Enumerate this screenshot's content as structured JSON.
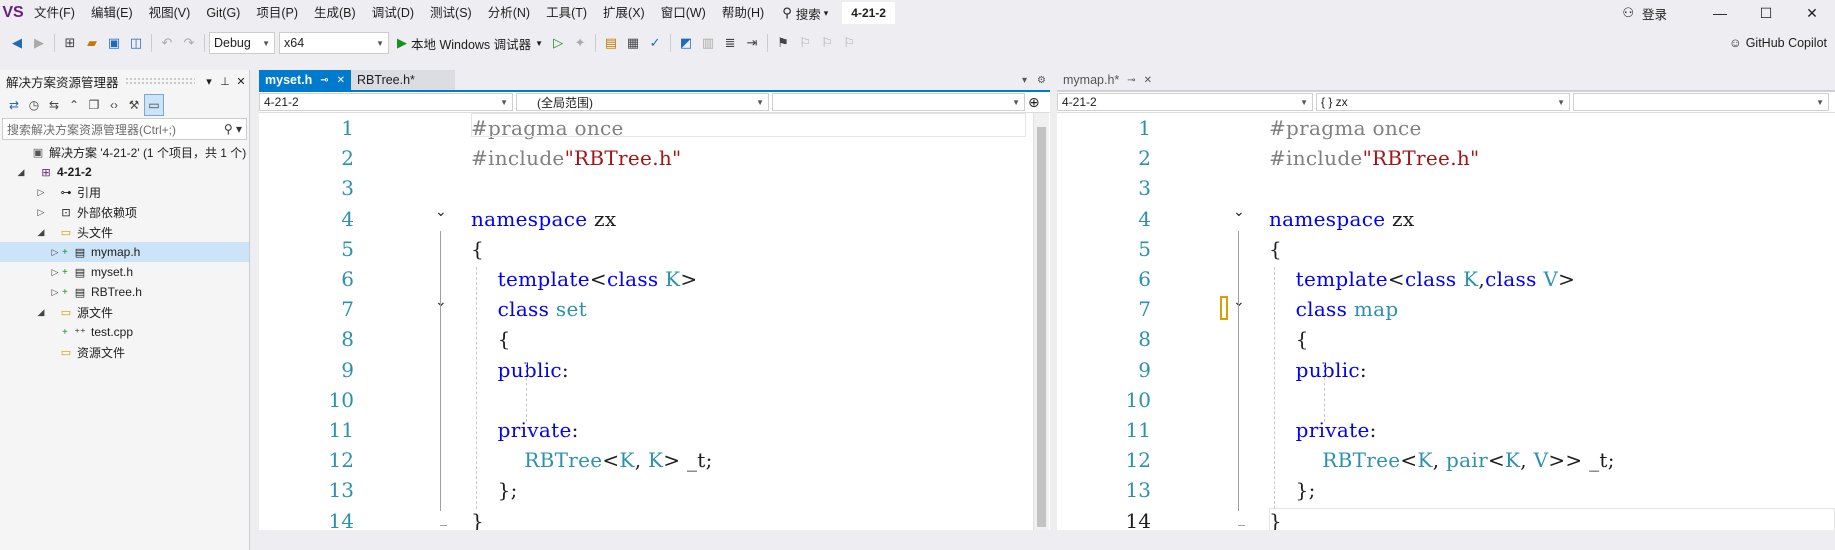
{
  "menubar": {
    "logo": "VS",
    "items": [
      "文件(F)",
      "编辑(E)",
      "视图(V)",
      "Git(G)",
      "项目(P)",
      "生成(B)",
      "调试(D)",
      "测试(S)",
      "分析(N)",
      "工具(T)",
      "扩展(X)",
      "窗口(W)",
      "帮助(H)"
    ],
    "search_label": "搜索",
    "search_arrow": "▾",
    "project_badge": "4-21-2",
    "login_label": "登录",
    "win_minimize": "—",
    "win_maximize": "☐",
    "win_close": "✕"
  },
  "toolbar": {
    "config": "Debug",
    "platform": "x64",
    "run_label": "本地 Windows 调试器",
    "copilot_label": "GitHub Copilot"
  },
  "solution_explorer": {
    "title": "解决方案资源管理器",
    "search_placeholder": "搜索解决方案资源管理器(Ctrl+;)",
    "tree": [
      {
        "label": "解决方案 '4-21-2' (1 个项目，共 1 个)",
        "expander": "",
        "icon": "▣",
        "plus": ""
      },
      {
        "label": "4-21-2",
        "expander": "◢",
        "icon": "⊞",
        "plus": "",
        "bold": true
      },
      {
        "label": "引用",
        "expander": "▷",
        "icon": "⊶",
        "plus": ""
      },
      {
        "label": "外部依赖项",
        "expander": "▷",
        "icon": "⊡",
        "plus": ""
      },
      {
        "label": "头文件",
        "expander": "◢",
        "icon": "▭",
        "plus": ""
      },
      {
        "label": "mymap.h",
        "expander": "▷",
        "icon": "▤",
        "plus": "+",
        "selected": true
      },
      {
        "label": "myset.h",
        "expander": "▷",
        "icon": "▤",
        "plus": "+"
      },
      {
        "label": "RBTree.h",
        "expander": "▷",
        "icon": "▤",
        "plus": "+"
      },
      {
        "label": "源文件",
        "expander": "◢",
        "icon": "▭",
        "plus": ""
      },
      {
        "label": "test.cpp",
        "expander": "",
        "icon": "⁺⁺",
        "plus": "+"
      },
      {
        "label": "资源文件",
        "expander": "",
        "icon": "▭",
        "plus": ""
      }
    ]
  },
  "editor_left": {
    "tabs": [
      {
        "label": "myset.h",
        "active": true
      },
      {
        "label": "RBTree.h*",
        "active": false
      }
    ],
    "nav_project": "4-21-2",
    "nav_scope": "(全局范围)",
    "nav_member": "",
    "lines": [
      [
        [
          "p",
          "#pragma once"
        ]
      ],
      [
        [
          "p",
          "#include"
        ],
        [
          "s",
          "\"RBTree.h\""
        ]
      ],
      [],
      [
        [
          "k",
          "namespace"
        ],
        [
          "o",
          " zx"
        ]
      ],
      [
        [
          "o",
          "{"
        ]
      ],
      [
        [
          "o",
          "    "
        ],
        [
          "k",
          "template"
        ],
        [
          "o",
          "<"
        ],
        [
          "k",
          "class"
        ],
        [
          "o",
          " "
        ],
        [
          "t",
          "K"
        ],
        [
          "o",
          ">"
        ]
      ],
      [
        [
          "o",
          "    "
        ],
        [
          "k",
          "class"
        ],
        [
          "o",
          " "
        ],
        [
          "t",
          "set"
        ]
      ],
      [
        [
          "o",
          "    {"
        ]
      ],
      [
        [
          "o",
          "    "
        ],
        [
          "k",
          "public"
        ],
        [
          "o",
          ":"
        ]
      ],
      [],
      [
        [
          "o",
          "    "
        ],
        [
          "k",
          "private"
        ],
        [
          "o",
          ":"
        ]
      ],
      [
        [
          "o",
          "        "
        ],
        [
          "t",
          "RBTree"
        ],
        [
          "o",
          "<"
        ],
        [
          "t",
          "K"
        ],
        [
          "o",
          ", "
        ],
        [
          "t",
          "K"
        ],
        [
          "o",
          "> _t;"
        ]
      ],
      [
        [
          "o",
          "    };"
        ]
      ],
      [
        [
          "o",
          "}"
        ]
      ]
    ]
  },
  "editor_right": {
    "tabs": [
      {
        "label": "mymap.h*",
        "active": false
      }
    ],
    "nav_project": "4-21-2",
    "nav_scope": "{ } zx",
    "nav_member": "",
    "lines": [
      [
        [
          "p",
          "#pragma once"
        ]
      ],
      [
        [
          "p",
          "#include"
        ],
        [
          "s",
          "\"RBTree.h\""
        ]
      ],
      [],
      [
        [
          "k",
          "namespace"
        ],
        [
          "o",
          " zx"
        ]
      ],
      [
        [
          "o",
          "{"
        ]
      ],
      [
        [
          "o",
          "    "
        ],
        [
          "k",
          "template"
        ],
        [
          "o",
          "<"
        ],
        [
          "k",
          "class"
        ],
        [
          "o",
          " "
        ],
        [
          "t",
          "K"
        ],
        [
          "o",
          ","
        ],
        [
          "k",
          "class"
        ],
        [
          "o",
          " "
        ],
        [
          "t",
          "V"
        ],
        [
          "o",
          ">"
        ]
      ],
      [
        [
          "o",
          "    "
        ],
        [
          "k",
          "class"
        ],
        [
          "o",
          " "
        ],
        [
          "t",
          "map"
        ]
      ],
      [
        [
          "o",
          "    {"
        ]
      ],
      [
        [
          "o",
          "    "
        ],
        [
          "k",
          "public"
        ],
        [
          "o",
          ":"
        ]
      ],
      [],
      [
        [
          "o",
          "    "
        ],
        [
          "k",
          "private"
        ],
        [
          "o",
          ":"
        ]
      ],
      [
        [
          "o",
          "        "
        ],
        [
          "t",
          "RBTree"
        ],
        [
          "o",
          "<"
        ],
        [
          "t",
          "K"
        ],
        [
          "o",
          ", "
        ],
        [
          "t",
          "pair"
        ],
        [
          "o",
          "<"
        ],
        [
          "t",
          "K"
        ],
        [
          "o",
          ", "
        ],
        [
          "t",
          "V"
        ],
        [
          "o",
          ">> _t;"
        ]
      ],
      [
        [
          "o",
          "    };"
        ]
      ],
      [
        [
          "o",
          "}"
        ]
      ]
    ],
    "current_line": 14
  },
  "line_numbers": [
    "1",
    "2",
    "3",
    "4",
    "5",
    "6",
    "7",
    "8",
    "9",
    "10",
    "11",
    "12",
    "13",
    "14"
  ]
}
